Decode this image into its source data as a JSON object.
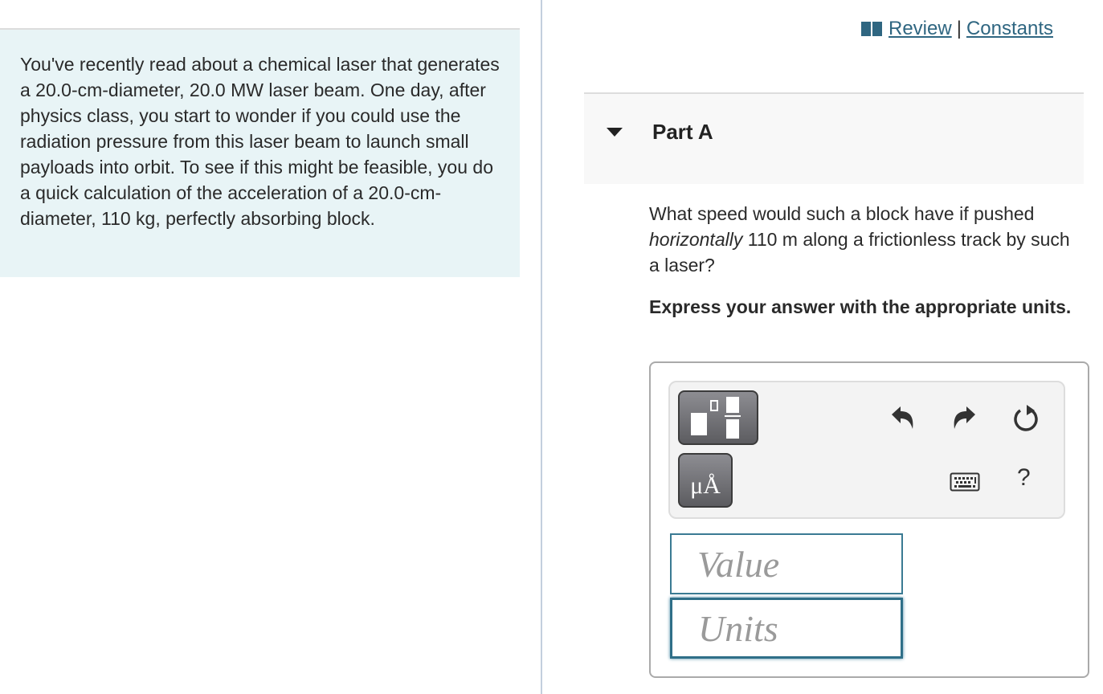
{
  "problem": {
    "intro": "You've recently read about a chemical laser that generates a 20.0-cm-diameter, 20.0 MW laser beam. One day, after physics class, you start to wonder if you could use the radiation pressure from this laser beam to launch small payloads into orbit. To see if this might be feasible, you do a quick calculation of the acceleration of a 20.0-cm-diameter, 110 kg, perfectly absorbing block."
  },
  "top_links": {
    "icon": "book-icon",
    "review": " Review",
    "separator": "|",
    "constants": "Constants"
  },
  "part": {
    "title": "Part A",
    "question_before": "What speed would such a block have if pushed ",
    "question_emph": "horizontally",
    "question_after": " 110 m along a frictionless track by such a laser?",
    "instruction": "Express your answer with the appropriate units."
  },
  "toolbar": {
    "templates_icon": "templates-icon",
    "units_label": "μÅ",
    "undo_icon": "undo-icon",
    "redo_icon": "redo-icon",
    "reset_icon": "reset-icon",
    "keyboard_icon": "keyboard-icon",
    "help_label": "?"
  },
  "inputs": {
    "value_placeholder": "Value",
    "value": "",
    "units_placeholder": "Units",
    "units": ""
  },
  "colors": {
    "intro_bg": "#e8f4f6",
    "link": "#2f6681",
    "input_border": "#3a7a93"
  }
}
